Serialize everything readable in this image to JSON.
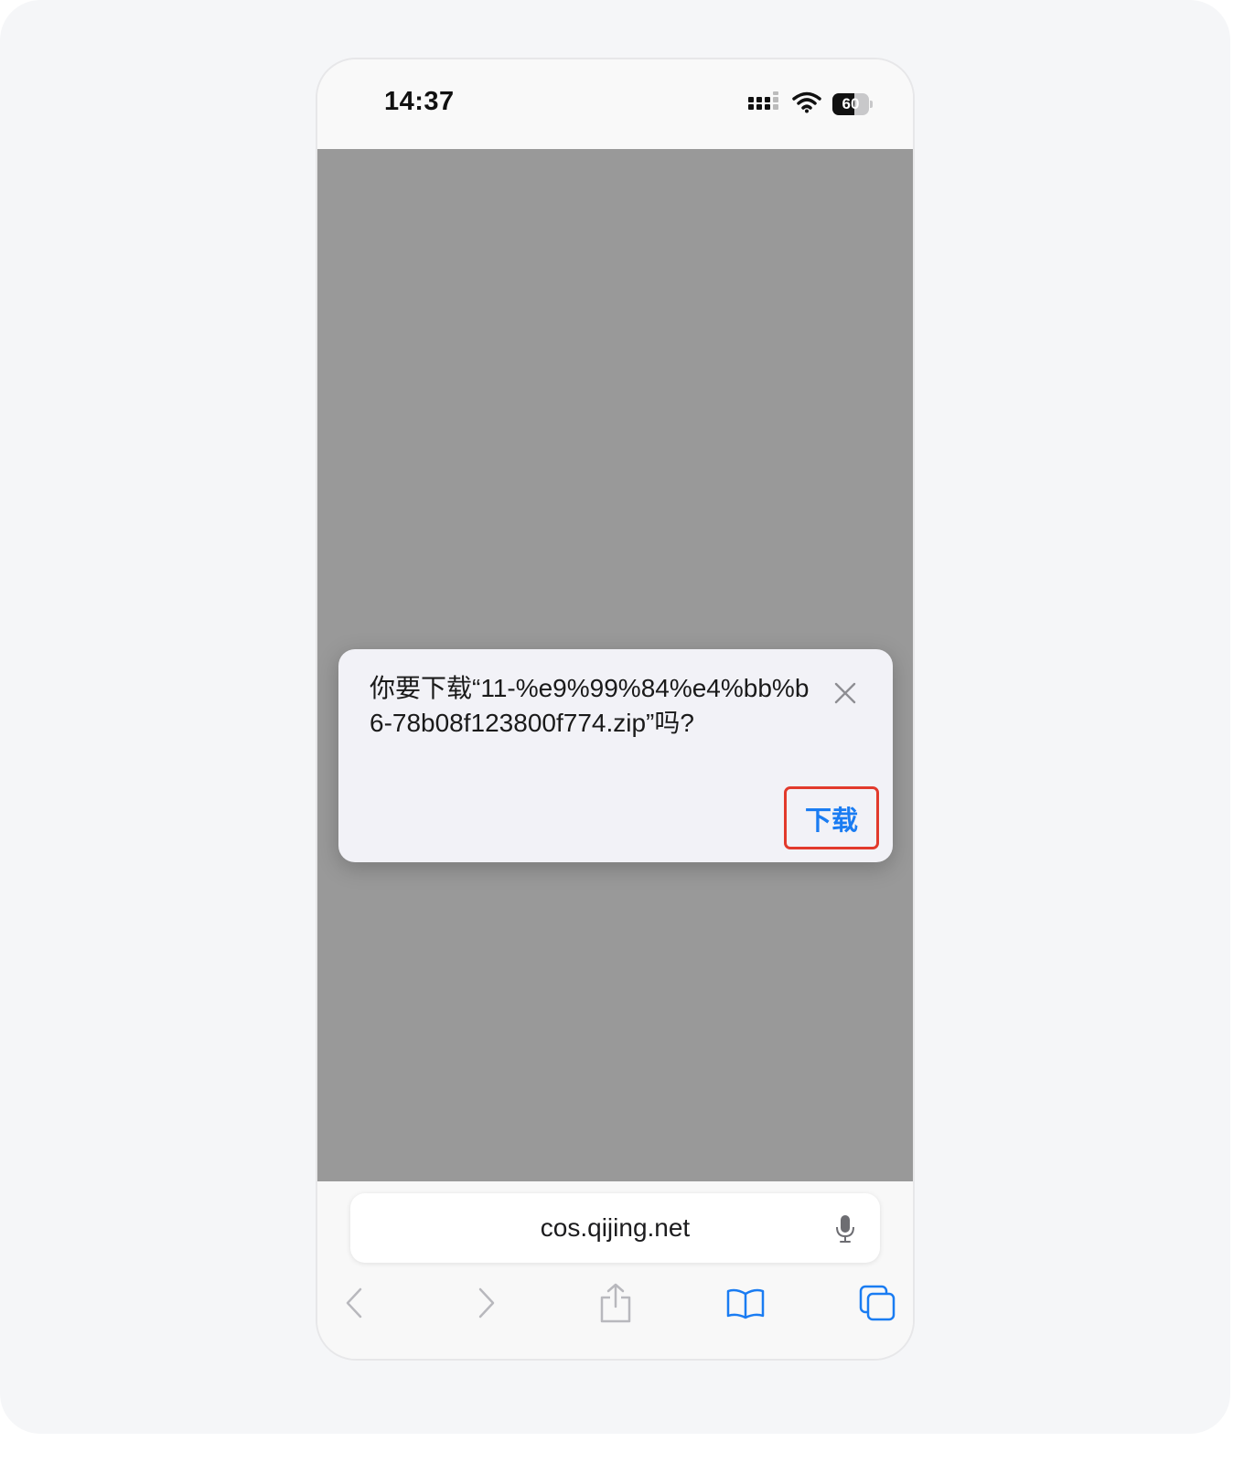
{
  "status_bar": {
    "time": "14:37",
    "battery_level": "60",
    "battery_fraction": 0.6
  },
  "dialog": {
    "message": "你要下载“11-%e9%99%84%e4%bb%b6-78b08f123800f774.zip”吗?",
    "close_icon": "close-icon",
    "download_label": "下载"
  },
  "browser": {
    "address": "cos.qijing.net",
    "mic_icon": "microphone-icon",
    "toolbar": {
      "back_icon": "chevron-left-icon",
      "forward_icon": "chevron-right-icon",
      "share_icon": "share-icon",
      "bookmarks_icon": "bookmarks-icon",
      "tabs_icon": "tabs-icon"
    }
  },
  "colors": {
    "accent": "#1a7cf2",
    "highlight": "#e23a2c",
    "web_overlay": "#999999"
  }
}
